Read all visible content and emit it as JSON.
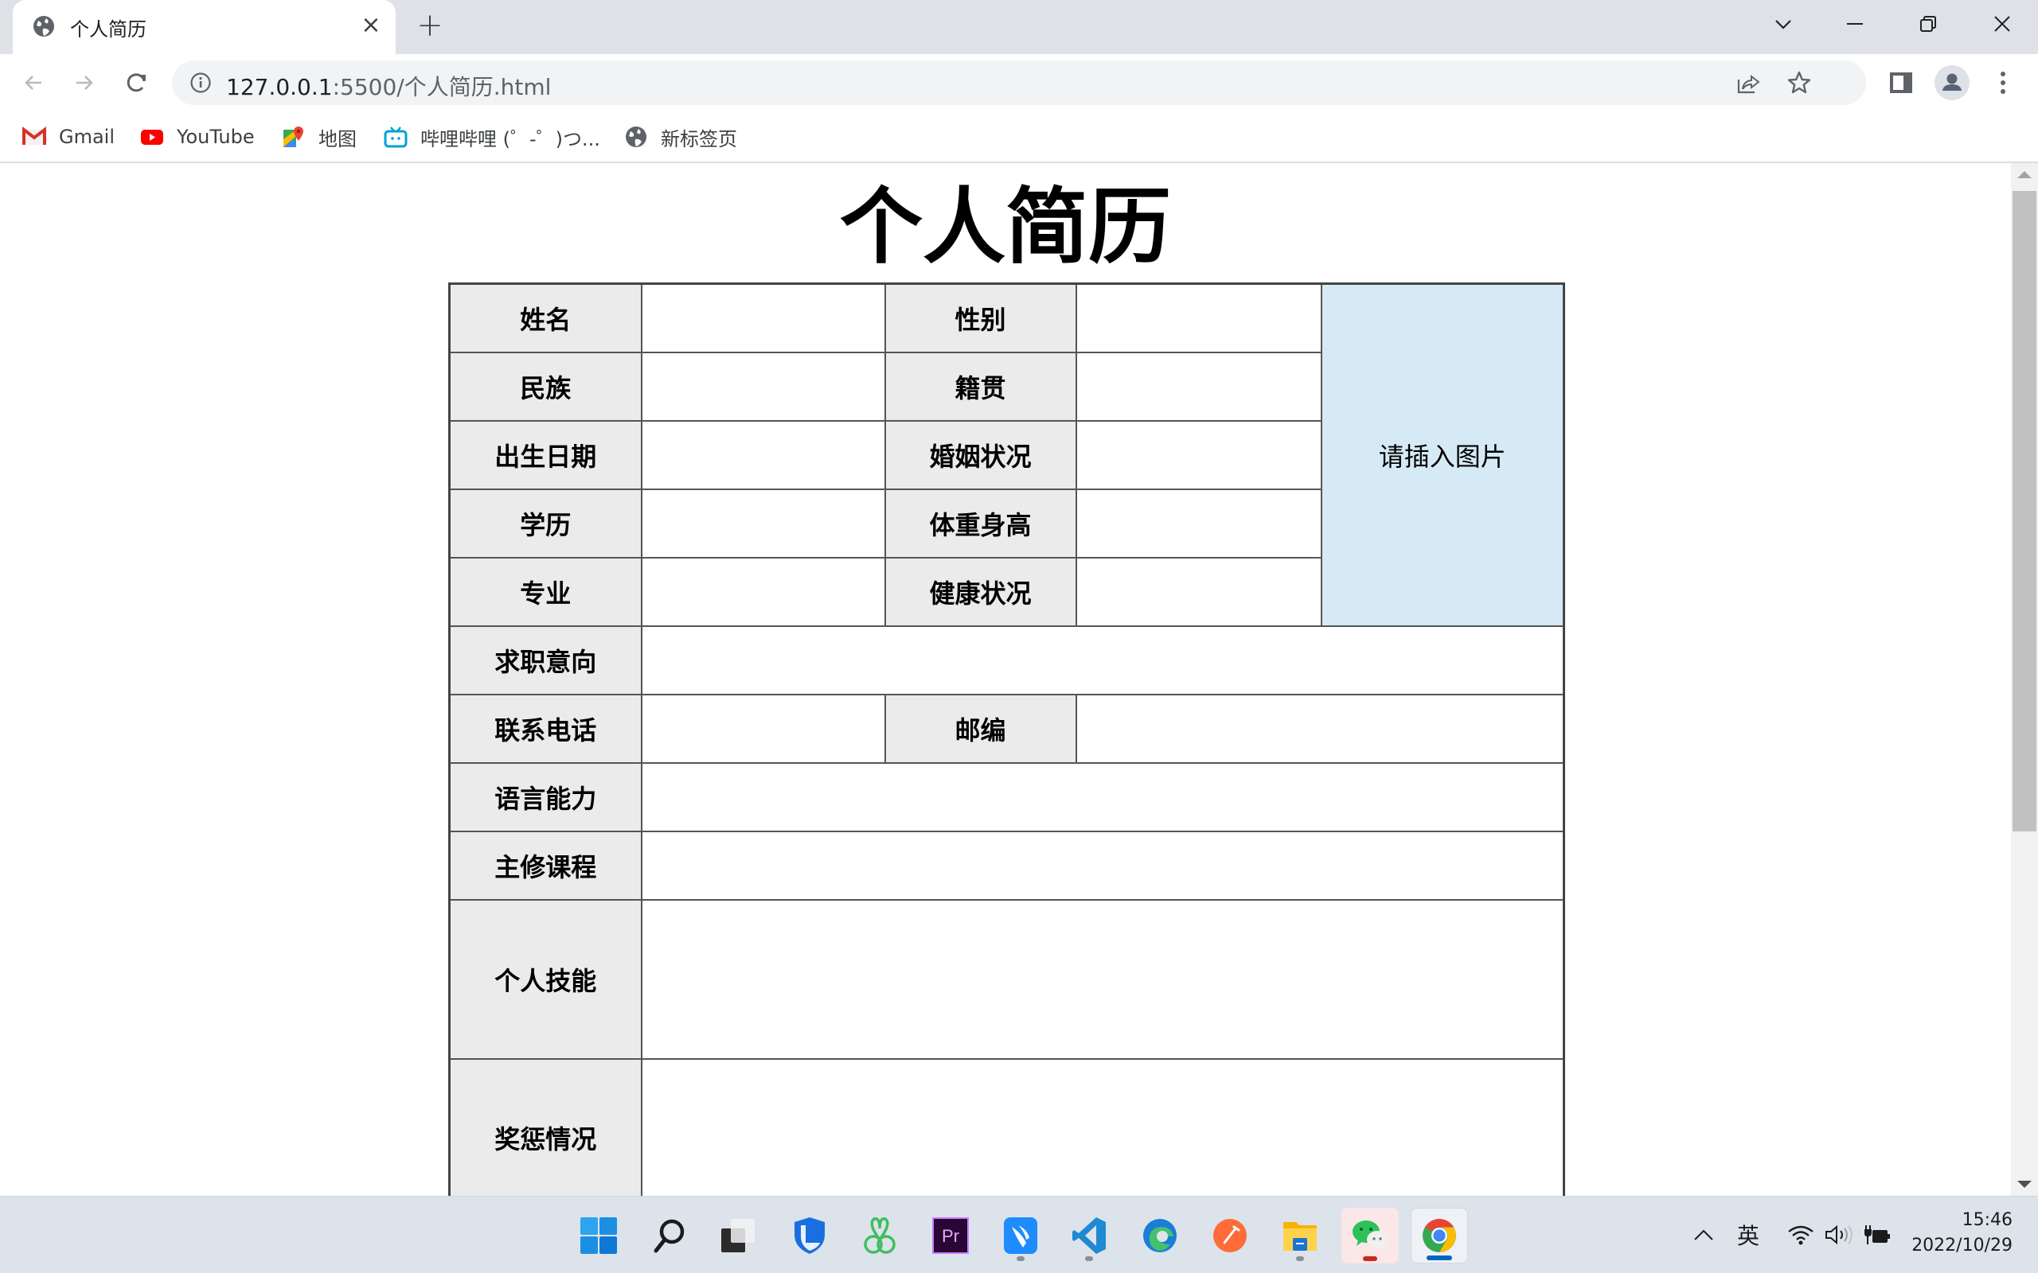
{
  "browser": {
    "tab": {
      "title": "个人简历",
      "favicon": "globe-icon",
      "close": "×"
    },
    "new_tab": "+",
    "window_controls": [
      "tab-search-icon",
      "minimize-icon",
      "restore-icon",
      "close-icon"
    ],
    "nav": [
      "back-icon",
      "forward-icon",
      "reload-icon"
    ],
    "address": {
      "host": "127.0.0.1",
      "path": ":5500/个人简历.html",
      "security_icon": "info-icon"
    },
    "omnibox_actions": [
      "share-icon",
      "star-icon"
    ],
    "toolbar_actions": [
      "side-panel-icon",
      "profile-icon",
      "menu-icon"
    ],
    "bookmarks": [
      {
        "label": "Gmail",
        "icon": "gmail-icon"
      },
      {
        "label": "YouTube",
        "icon": "youtube-icon"
      },
      {
        "label": "地图",
        "icon": "maps-icon"
      },
      {
        "label": "哔哩哔哩 (゜-゜)つ...",
        "icon": "bilibili-icon"
      },
      {
        "label": "新标签页",
        "icon": "globe-icon"
      }
    ]
  },
  "page": {
    "title": "个人简历",
    "photo_placeholder": "请插入图片",
    "labels": {
      "name": "姓名",
      "gender": "性别",
      "ethnicity": "民族",
      "native_place": "籍贯",
      "birth_date": "出生日期",
      "marital_status": "婚姻状况",
      "education": "学历",
      "height_weight": "体重身高",
      "major": "专业",
      "health": "健康状况",
      "job_intention": "求职意向",
      "phone": "联系电话",
      "postcode": "邮编",
      "language": "语言能力",
      "courses": "主修课程",
      "skills": "个人技能",
      "awards": "奖惩情况"
    },
    "values": {
      "name": "",
      "gender": "",
      "ethnicity": "",
      "native_place": "",
      "birth_date": "",
      "marital_status": "",
      "education": "",
      "height_weight": "",
      "major": "",
      "health": "",
      "job_intention": "",
      "phone": "",
      "postcode": "",
      "language": "",
      "courses": "",
      "skills": "",
      "awards": ""
    }
  },
  "taskbar": {
    "apps": [
      {
        "name": "start",
        "running": false
      },
      {
        "name": "search",
        "running": false
      },
      {
        "name": "task-view",
        "running": false
      },
      {
        "name": "security-shield",
        "running": false
      },
      {
        "name": "navicat",
        "running": false
      },
      {
        "name": "premiere-pro",
        "running": false,
        "label": "Pr"
      },
      {
        "name": "feishu",
        "running": true
      },
      {
        "name": "vscode",
        "running": true
      },
      {
        "name": "edge",
        "running": false
      },
      {
        "name": "postman",
        "running": false
      },
      {
        "name": "file-explorer",
        "running": true
      },
      {
        "name": "wechat",
        "running": true,
        "attention": true
      },
      {
        "name": "chrome",
        "running": true,
        "active": true
      }
    ],
    "tray": {
      "ime": "英",
      "expand": "^"
    },
    "clock": {
      "time": "15:46",
      "date": "2022/10/29"
    }
  }
}
